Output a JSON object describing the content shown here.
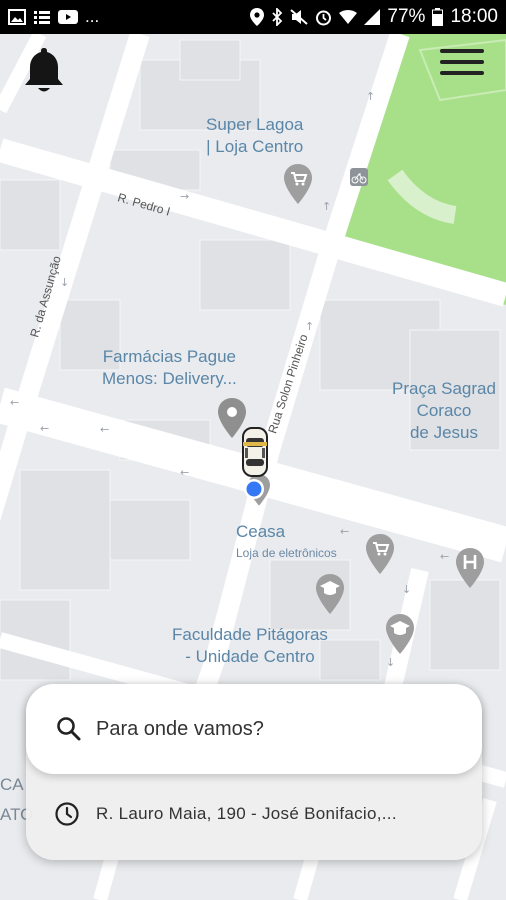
{
  "status_bar": {
    "battery_percent": "77%",
    "time": "18:00",
    "overflow": "..."
  },
  "map": {
    "places": [
      {
        "name": "Super Lagoa\n| Loja Centro"
      },
      {
        "name": "Farmácias Pague\nMenos: Delivery..."
      },
      {
        "name": "Praça Sagrad\nCoraco\nde Jesus"
      },
      {
        "name": "Ceasa"
      },
      {
        "name": "Loja de eletrônicos"
      },
      {
        "name": "Faculdade Pitágoras\n- Unidade Centro"
      }
    ],
    "streets": {
      "pedro": "R. Pedro I",
      "assuncao": "R. da Assunção",
      "solon": "Rua Solon Pinheiro"
    },
    "edge_text": {
      "a": "CA",
      "b": "ATO"
    },
    "colors": {
      "park": "#a6e087",
      "road": "#ffffff",
      "block": "#e6e8eb",
      "location_dot": "#3478f6",
      "poi_pin": "#9e9e9e"
    }
  },
  "search": {
    "placeholder_text": "Para onde vamos?",
    "recent_address": "R. Lauro Maia, 190 - José Bonifacio,..."
  },
  "icons": {
    "bell": "bell-icon",
    "menu": "menu-icon",
    "search": "search-icon",
    "history": "clock-icon",
    "car": "car-icon"
  }
}
